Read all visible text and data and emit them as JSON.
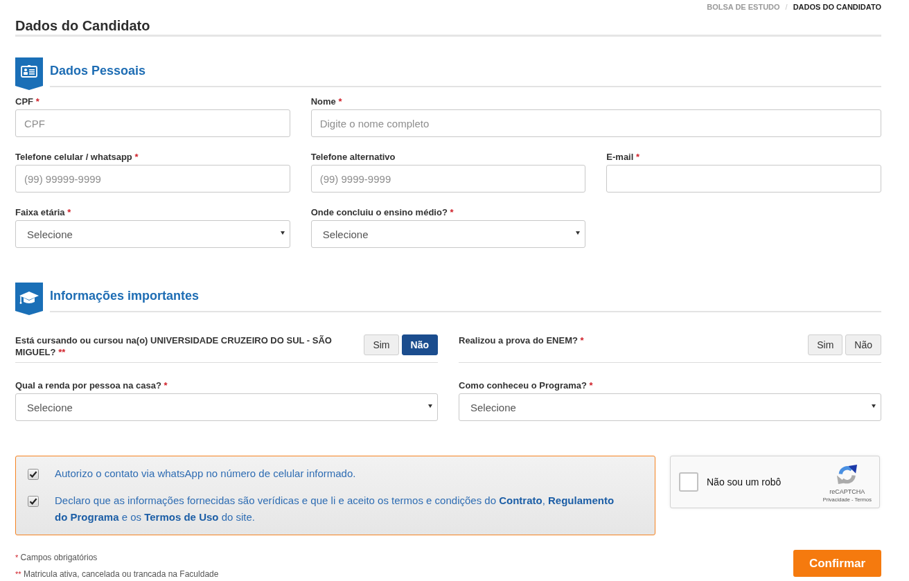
{
  "breadcrumb": {
    "items": [
      {
        "label": "BOLSA DE ESTUDO",
        "current": false
      },
      {
        "label": "DADOS DO CANDIDATO",
        "current": true
      }
    ],
    "separator": "/"
  },
  "page_title": "Dados do Candidato",
  "sections": [
    {
      "title": "Dados Pessoais",
      "rows": [
        [
          {
            "kind": "text",
            "label": "CPF",
            "mark": "*",
            "placeholder": "CPF"
          },
          {
            "kind": "text",
            "label": "Nome",
            "mark": "*",
            "placeholder": "Digite o nome completo"
          }
        ],
        [
          {
            "kind": "text",
            "label": "Telefone celular / whatsapp",
            "mark": "*",
            "placeholder": "(99) 99999-9999"
          },
          {
            "kind": "text",
            "label": "Telefone alternativo",
            "placeholder": "(99) 9999-9999"
          },
          {
            "kind": "text",
            "label": "E-mail",
            "mark": "*"
          }
        ],
        [
          {
            "kind": "select",
            "label": "Faixa etária",
            "mark": "*",
            "value": "Selecione"
          },
          {
            "kind": "select",
            "label": "Onde concluiu o ensino médio?",
            "mark": "*",
            "value": "Selecione"
          }
        ]
      ]
    },
    {
      "title": "Informações importantes",
      "rows": [
        [
          {
            "kind": "toggle",
            "label": "Está cursando ou cursou na(o) UNIVERSIDADE CRUZEIRO DO SUL - SÃO MIGUEL?",
            "mark": "**",
            "options": [
              {
                "label": "Sim",
                "selected": false
              },
              {
                "label": "Não",
                "selected": true
              }
            ]
          },
          {
            "kind": "toggle",
            "label": "Realizou a prova do ENEM?",
            "mark": "*",
            "options": [
              {
                "label": "Sim",
                "selected": false
              },
              {
                "label": "Não",
                "selected": false
              }
            ]
          }
        ],
        [
          {
            "kind": "select",
            "label": "Qual a renda por pessoa na casa?",
            "mark": "*",
            "value": "Selecione"
          },
          {
            "kind": "select",
            "label": "Como conheceu o Programa?",
            "mark": "*",
            "value": "Selecione"
          }
        ]
      ]
    }
  ],
  "consents": [
    {
      "text": "Autorizo o contato via whatsApp no número de celular informado.",
      "checked": true
    },
    {
      "text": "Declaro que as informações fornecidas são verídicas e que li e aceito os termos e condições do **Contrato**, **Regulamento do Programa** e os **Termos de Uso** do site.",
      "checked": true
    }
  ],
  "captcha": {
    "checked": false,
    "label": "Não sou um robô",
    "brand": "reCAPTCHA",
    "links": [
      {
        "label": "Privacidade"
      },
      {
        "label": "Termos"
      }
    ],
    "separator": "-"
  },
  "footnotes": [
    {
      "mark": "*",
      "text": "Campos obrigatórios"
    },
    {
      "mark": "**",
      "text": "Matricula ativa, cancelada ou trancada na Faculdade"
    }
  ],
  "submit": {
    "label": "Confirmar"
  }
}
